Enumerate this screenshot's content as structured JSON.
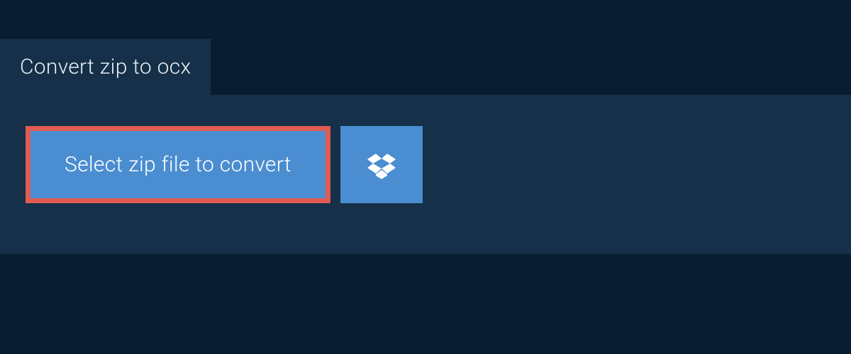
{
  "tab": {
    "label": "Convert zip to ocx"
  },
  "panel": {
    "select_button_label": "Select zip file to convert"
  }
}
